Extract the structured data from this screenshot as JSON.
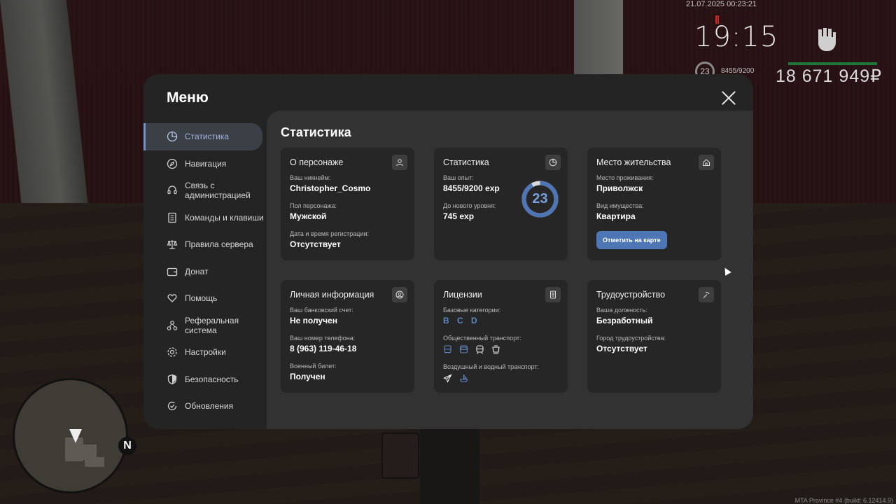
{
  "hud": {
    "datetime": "21.07.2025 00:23:21",
    "clock": "19:15",
    "level": "23",
    "exp": "8455/9200",
    "money": "18 671 949₽",
    "compass": "N",
    "build": "MTA Province #4 (build: 6.12414.9)"
  },
  "menu": {
    "title": "Меню",
    "sidebar": [
      {
        "label": "Статистика",
        "icon": "pie-chart-icon",
        "active": true
      },
      {
        "label": "Навигация",
        "icon": "compass-icon"
      },
      {
        "label": "Связь с администрацией",
        "icon": "headset-icon"
      },
      {
        "label": "Команды и клавиши",
        "icon": "document-icon"
      },
      {
        "label": "Правила сервера",
        "icon": "scales-icon"
      },
      {
        "label": "Донат",
        "icon": "wallet-icon"
      },
      {
        "label": "Помощь",
        "icon": "heart-hand-icon"
      },
      {
        "label": "Реферальная система",
        "icon": "network-icon"
      },
      {
        "label": "Настройки",
        "icon": "gear-icon"
      },
      {
        "label": "Безопасность",
        "icon": "shield-icon"
      },
      {
        "label": "Обновления",
        "icon": "refresh-check-icon"
      }
    ],
    "content_title": "Статистика",
    "cards": {
      "character": {
        "title": "О персонаже",
        "nickname_label": "Ваш никнейм:",
        "nickname": "Christopher_Cosmo",
        "gender_label": "Пол персонажа:",
        "gender": "Мужской",
        "reg_label": "Дата и время регистрации:",
        "reg": "Отсутствует"
      },
      "stats": {
        "title": "Статистика",
        "exp_label": "Ваш опыт:",
        "exp": "8455/9200 exp",
        "next_label": "До нового уровня:",
        "next": "745 exp",
        "level": "23",
        "progress": 0.919
      },
      "residence": {
        "title": "Место жительства",
        "place_label": "Место проживания:",
        "place": "Приволжск",
        "property_label": "Вид имущества:",
        "property": "Квартира",
        "button": "Отметить на карте"
      },
      "personal": {
        "title": "Личная информация",
        "bank_label": "Ваш банковский счет:",
        "bank": "Не получен",
        "phone_label": "Ваш номер телефона:",
        "phone": "8 (963) 119-46-18",
        "military_label": "Военный билет:",
        "military": "Получен"
      },
      "licenses": {
        "title": "Лицензии",
        "base_label": "Базовые категории:",
        "base": "B C D",
        "public_label": "Общественный транспорт:",
        "air_label": "Воздушный и водный транспорт:"
      },
      "job": {
        "title": "Трудоустройство",
        "position_label": "Ваша должность:",
        "position": "Безработный",
        "city_label": "Город трудоустройства:",
        "city": "Отсутствует"
      }
    }
  }
}
